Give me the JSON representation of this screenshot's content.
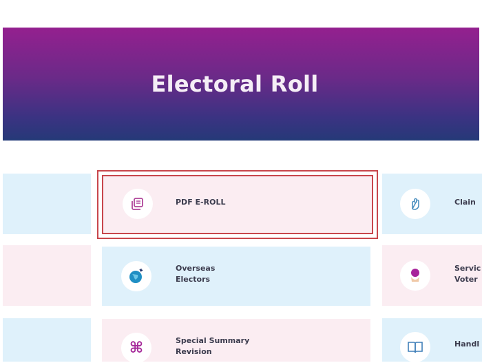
{
  "banner": {
    "title": "Electoral Roll"
  },
  "cards": {
    "pdf_eroll": {
      "label": "PDF E-ROLL",
      "icon": "document-stack-icon"
    },
    "overseas": {
      "label": "Overseas\nElectors",
      "icon": "globe-icon"
    },
    "special_summary": {
      "label": "Special Summary\nRevision",
      "icon": "command-icon"
    },
    "claims": {
      "label": "Clain",
      "icon": "hand-icon"
    },
    "service": {
      "label": "Servic\nVoter",
      "icon": "person-pin-icon"
    },
    "handbook": {
      "label": "Handl",
      "icon": "book-icon"
    }
  },
  "colors": {
    "banner_top": "#94208f",
    "banner_bottom": "#263978",
    "card_blue": "#dff1fb",
    "card_pink": "#fbedf2",
    "highlight": "#c8464c"
  }
}
